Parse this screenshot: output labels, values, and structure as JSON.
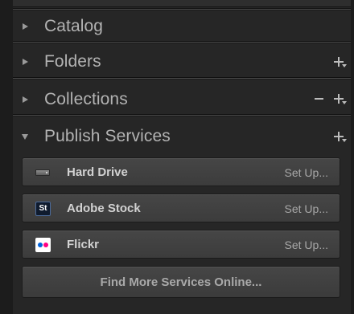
{
  "panels": {
    "catalog": {
      "label": "Catalog",
      "expanded": false
    },
    "folders": {
      "label": "Folders",
      "expanded": false,
      "actions": [
        "add"
      ]
    },
    "collections": {
      "label": "Collections",
      "expanded": false,
      "actions": [
        "remove",
        "add"
      ]
    },
    "publish_services": {
      "label": "Publish Services",
      "expanded": true,
      "actions": [
        "add"
      ],
      "services": [
        {
          "name": "Hard Drive",
          "action_label": "Set Up...",
          "icon": "hard-drive-icon"
        },
        {
          "name": "Adobe Stock",
          "action_label": "Set Up...",
          "icon": "adobe-stock-icon",
          "icon_text": "St"
        },
        {
          "name": "Flickr",
          "action_label": "Set Up...",
          "icon": "flickr-icon"
        }
      ],
      "find_more_label": "Find More Services Online..."
    }
  },
  "colors": {
    "panel_bg": "#262626",
    "button_bg": "#444444",
    "text_primary": "#d2d2d2",
    "text_secondary": "#a8a8a8",
    "header_text": "#b3b3b3",
    "flickr_blue": "#0063dc",
    "flickr_pink": "#ff0084",
    "stock_bg": "#0f1b2e"
  }
}
